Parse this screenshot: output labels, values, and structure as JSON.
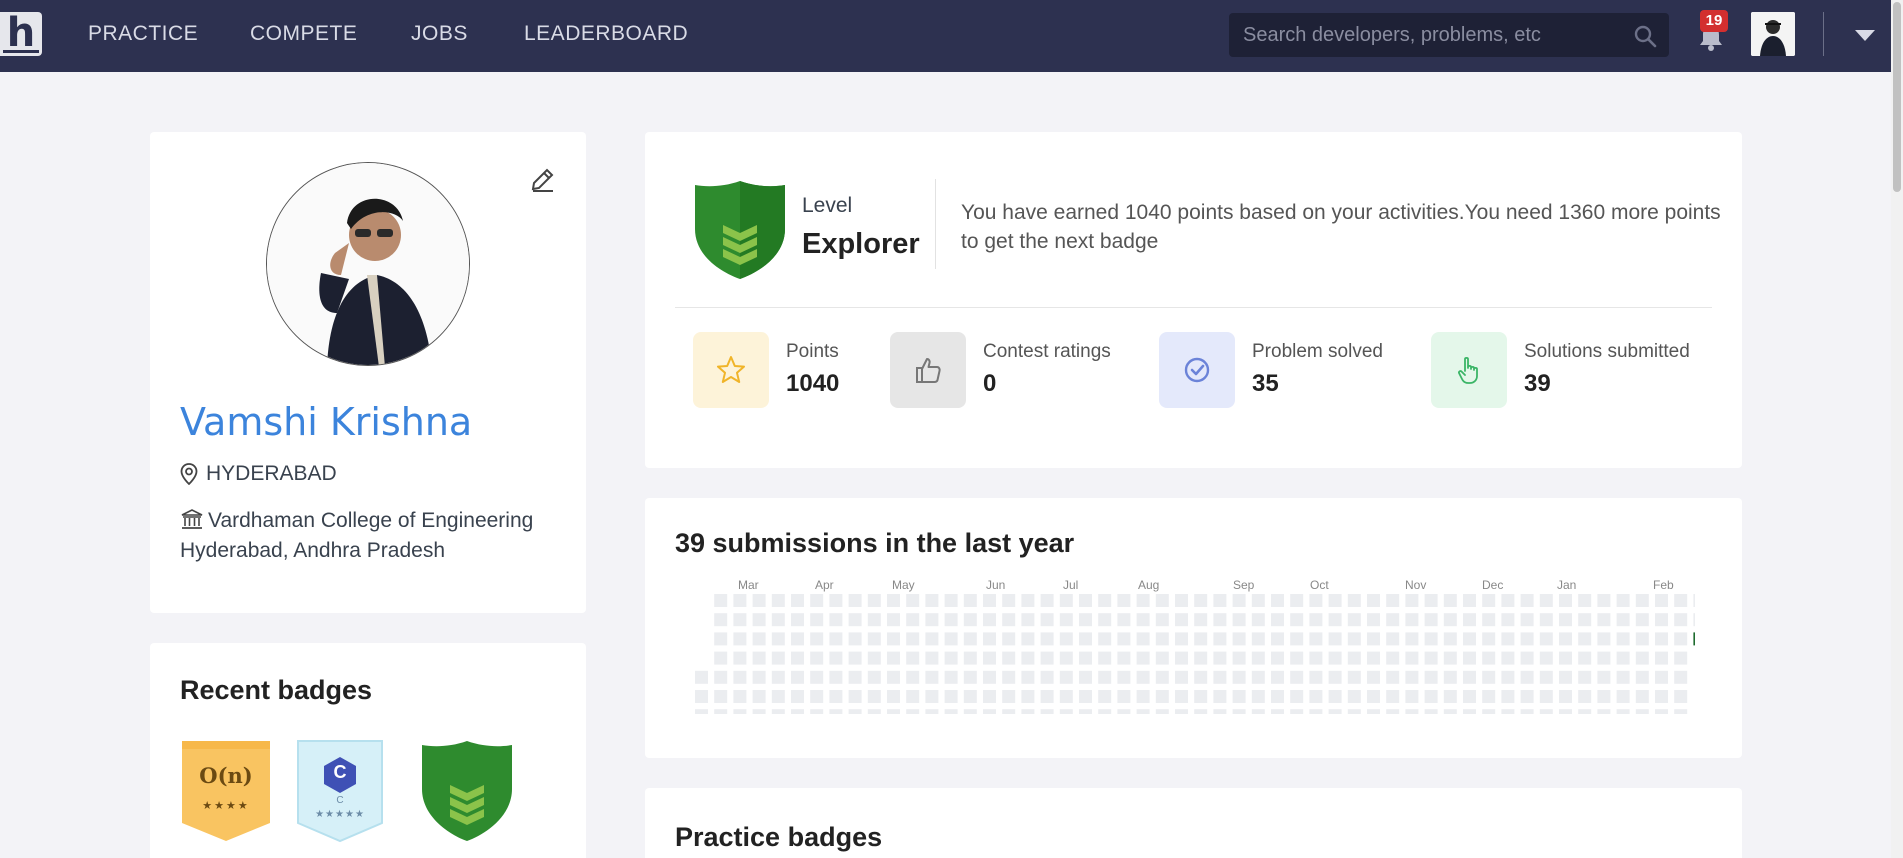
{
  "nav": {
    "logo": "h",
    "items": [
      "PRACTICE",
      "COMPETE",
      "JOBS",
      "LEADERBOARD"
    ],
    "search_placeholder": "Search developers, problems, etc",
    "notification_count": "19"
  },
  "profile": {
    "name": "Vamshi Krishna",
    "location": "HYDERABAD",
    "college": "Vardhaman College of Engineering Hyderabad, Andhra Pradesh"
  },
  "recent_badges": {
    "title": "Recent badges",
    "badges": [
      {
        "label": "O(n)",
        "stars": "★★★★",
        "stars_count": 4,
        "color": "#f9c461"
      },
      {
        "label": "C",
        "sublabel": "C",
        "stars": "★★★★★",
        "stars_count": 5,
        "color": "#d6f0f8"
      },
      {
        "label": "",
        "color": "#2e8b2e"
      }
    ]
  },
  "level": {
    "label": "Level",
    "value": "Explorer",
    "description": "You have earned 1040 points based on your activities.You need 1360 more points to get the next badge"
  },
  "stats": [
    {
      "label": "Points",
      "value": "1040",
      "icon": "star-icon",
      "bg": "#fdf3d9",
      "color": "#f0b429"
    },
    {
      "label": "Contest ratings",
      "value": "0",
      "icon": "thumbs-up-icon",
      "bg": "#e6e6e6",
      "color": "#777777"
    },
    {
      "label": "Problem solved",
      "value": "35",
      "icon": "check-circle-icon",
      "bg": "#e4e9fb",
      "color": "#6b83d8"
    },
    {
      "label": "Solutions submitted",
      "value": "39",
      "icon": "pointer-hand-icon",
      "bg": "#e4f7ea",
      "color": "#3bb567"
    }
  ],
  "submissions": {
    "title": "39 submissions in the last year",
    "months": [
      "Mar",
      "Apr",
      "May",
      "Jun",
      "Jul",
      "Aug",
      "Sep",
      "Oct",
      "Nov",
      "Dec",
      "Jan",
      "Feb"
    ],
    "empty_color": "#ebedf0",
    "active_color": "#1e6b2e"
  },
  "practice": {
    "title": "Practice badges"
  }
}
